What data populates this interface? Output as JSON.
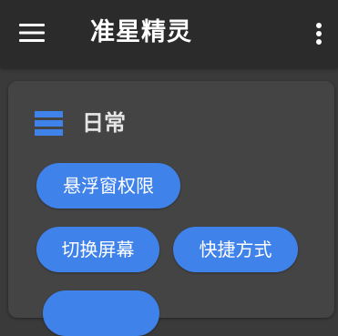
{
  "app_bar": {
    "title": "准星精灵",
    "menu_icon": "hamburger-menu-icon",
    "more_icon": "more-vertical-icon",
    "background": "#2b2b2b"
  },
  "section": {
    "icon": "list-icon",
    "title": "日常",
    "accent": "#3f82ea",
    "buttons": [
      {
        "label": "悬浮窗权限"
      },
      {
        "label": "切换屏幕"
      },
      {
        "label": "快捷方式"
      },
      {
        "label": ""
      }
    ]
  }
}
